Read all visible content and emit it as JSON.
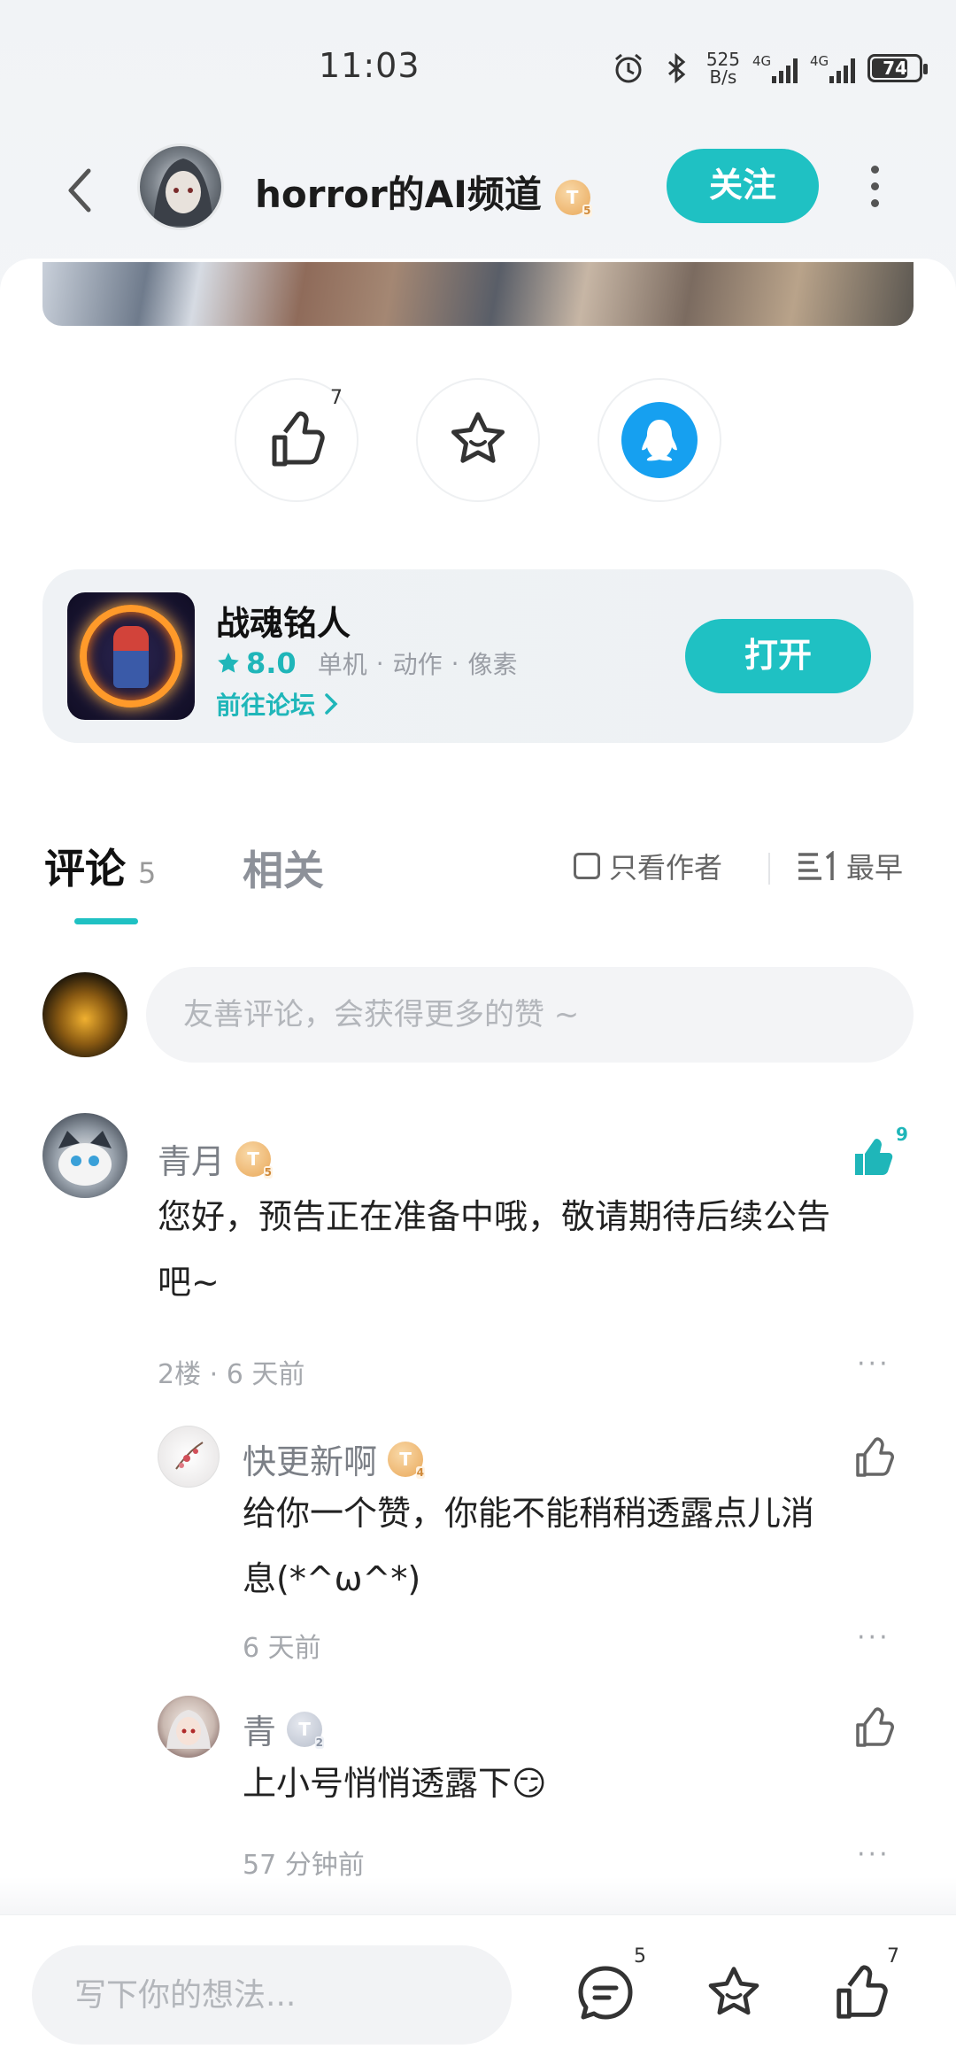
{
  "status_bar": {
    "time": "11:03",
    "net_speed_value": "525",
    "net_speed_unit": "B/s",
    "sim1_tag": "4G",
    "sim2_tag": "4G",
    "battery": "74"
  },
  "header": {
    "channel_name": "horror的AI频道",
    "channel_level": "T",
    "channel_level_num": "5",
    "follow_label": "关注"
  },
  "actions": {
    "like_count": "7"
  },
  "game": {
    "name": "战魂铭人",
    "rating": "8.0",
    "tags": [
      "单机",
      "动作",
      "像素"
    ],
    "forum_link": "前往论坛",
    "open_label": "打开"
  },
  "tabs": {
    "comments_label": "评论",
    "comments_count": "5",
    "related_label": "相关",
    "author_only_label": "只看作者",
    "sort_label": "最早"
  },
  "comment_input": {
    "placeholder": "友善评论，会获得更多的赞 ~"
  },
  "comments": [
    {
      "name": "青月",
      "level": "T",
      "level_num": "5",
      "text_line1": "您好，预告正在准备中哦，敬请期待后续公告",
      "text_line2": "吧~",
      "meta": "2楼 · 6 天前",
      "likes": "9",
      "more": "···"
    },
    {
      "name": "快更新啊",
      "level": "T",
      "level_num": "4",
      "text_line1": "给你一个赞，你能不能稍稍透露点儿消",
      "text_line2": "息(*^ω^*)",
      "meta": "6 天前",
      "more": "···"
    },
    {
      "name": "青",
      "level": "T",
      "level_num": "2",
      "text": "上小号悄悄透露下",
      "emoji": "😏",
      "meta": "57 分钟前",
      "more": "···"
    }
  ],
  "bottom_bar": {
    "placeholder": "写下你的想法...",
    "comment_count": "5",
    "like_count": "7"
  },
  "colors": {
    "accent": "#1fc1c3",
    "qq_blue": "#16a0f0"
  }
}
